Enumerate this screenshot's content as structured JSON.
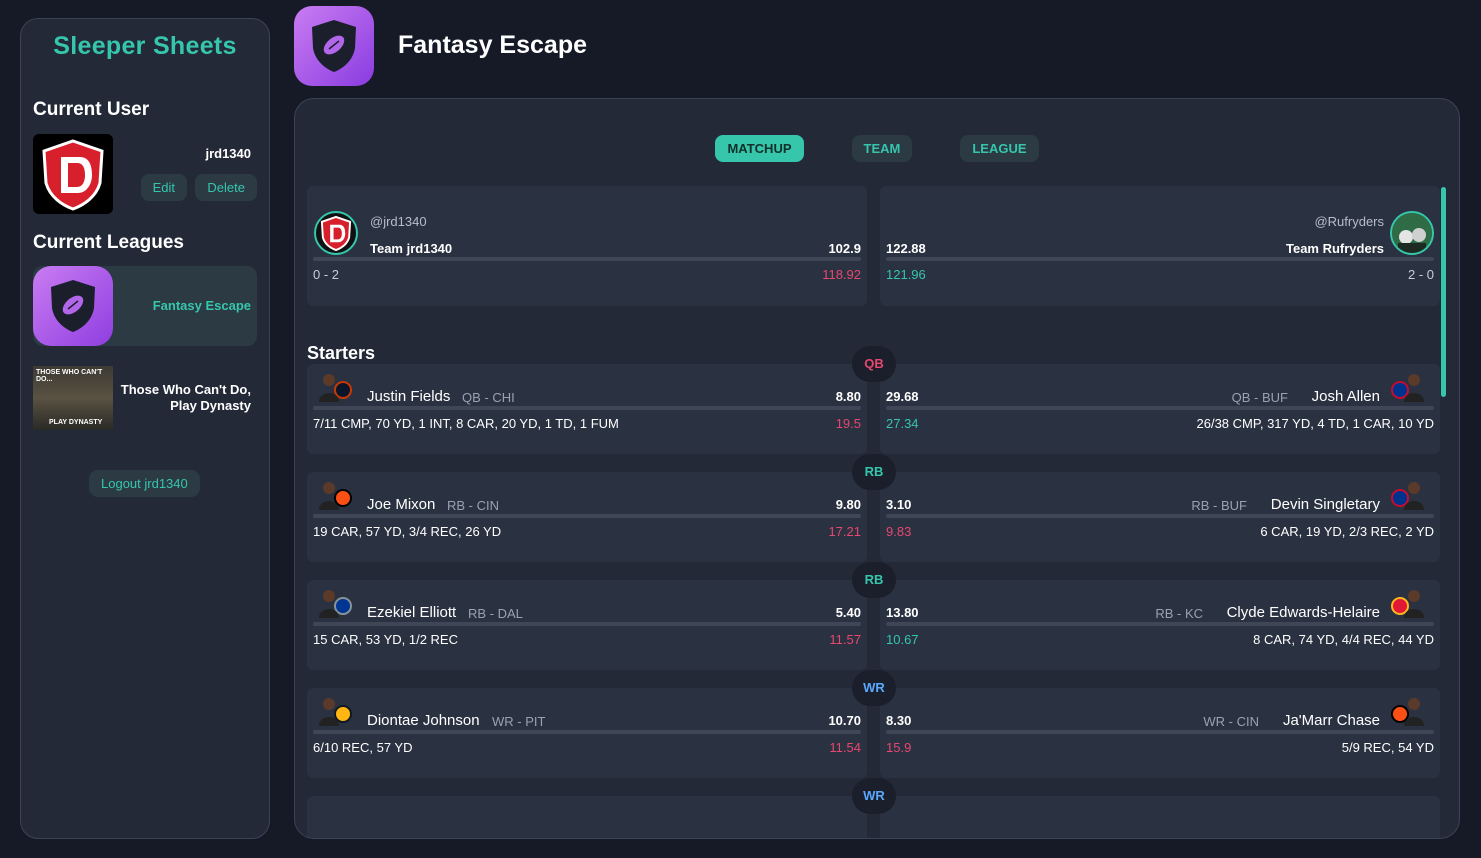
{
  "app": {
    "title": "Sleeper Sheets"
  },
  "sidebar": {
    "current_user_heading": "Current User",
    "username": "jrd1340",
    "edit_label": "Edit",
    "delete_label": "Delete",
    "current_leagues_heading": "Current Leagues",
    "leagues": [
      {
        "name": "Fantasy Escape",
        "active": true
      },
      {
        "name": "Those Who Can't Do, Play Dynasty",
        "image_text_top": "THOSE WHO CAN'T DO...",
        "image_text_bottom": "PLAY DYNASTY",
        "active": false
      }
    ],
    "logout_label": "Logout jrd1340"
  },
  "header": {
    "league_title": "Fantasy Escape"
  },
  "tabs": [
    {
      "label": "MATCHUP",
      "active": true
    },
    {
      "label": "TEAM",
      "active": false
    },
    {
      "label": "LEAGUE",
      "active": false
    }
  ],
  "matchup": {
    "left": {
      "handle": "@jrd1340",
      "team": "Team jrd1340",
      "score": "102.9",
      "record": "0 - 2",
      "projected": "118.92"
    },
    "right": {
      "handle": "@Rufryders",
      "team": "Team Rufryders",
      "score": "122.88",
      "record": "2 - 0",
      "projected": "121.96"
    }
  },
  "starters_heading": "Starters",
  "starters": [
    {
      "position": "QB",
      "left": {
        "name": "Justin Fields",
        "pos_team": "QB - CHI",
        "points": "8.80",
        "stats": "7/11 CMP, 70 YD, 1 INT, 8 CAR, 20 YD, 1 TD, 1 FUM",
        "projected": "19.5",
        "proj_color": "red"
      },
      "right": {
        "name": "Josh Allen",
        "pos_team": "QB - BUF",
        "points": "29.68",
        "stats": "26/38 CMP, 317 YD, 4 TD, 1 CAR, 10 YD",
        "projected": "27.34",
        "proj_color": "green"
      }
    },
    {
      "position": "RB",
      "left": {
        "name": "Joe Mixon",
        "pos_team": "RB - CIN",
        "points": "9.80",
        "stats": "19 CAR, 57 YD, 3/4 REC, 26 YD",
        "projected": "17.21",
        "proj_color": "red"
      },
      "right": {
        "name": "Devin Singletary",
        "pos_team": "RB - BUF",
        "points": "3.10",
        "stats": "6 CAR, 19 YD, 2/3 REC, 2 YD",
        "projected": "9.83",
        "proj_color": "red"
      }
    },
    {
      "position": "RB",
      "left": {
        "name": "Ezekiel Elliott",
        "pos_team": "RB - DAL",
        "points": "5.40",
        "stats": "15 CAR, 53 YD, 1/2 REC",
        "projected": "11.57",
        "proj_color": "red"
      },
      "right": {
        "name": "Clyde Edwards-Helaire",
        "pos_team": "RB - KC",
        "points": "13.80",
        "stats": "8 CAR, 74 YD, 4/4 REC, 44 YD",
        "projected": "10.67",
        "proj_color": "green"
      }
    },
    {
      "position": "WR",
      "left": {
        "name": "Diontae Johnson",
        "pos_team": "WR - PIT",
        "points": "10.70",
        "stats": "6/10 REC, 57 YD",
        "projected": "11.54",
        "proj_color": "red"
      },
      "right": {
        "name": "Ja'Marr Chase",
        "pos_team": "WR - CIN",
        "points": "8.30",
        "stats": "5/9 REC, 54 YD",
        "projected": "15.9",
        "proj_color": "red"
      }
    },
    {
      "position": "WR"
    }
  ],
  "colors": {
    "accent": "#35c6ac",
    "negative": "#e8476f",
    "wr": "#5aa8ff",
    "panel": "#232937",
    "card": "#2a3140"
  }
}
